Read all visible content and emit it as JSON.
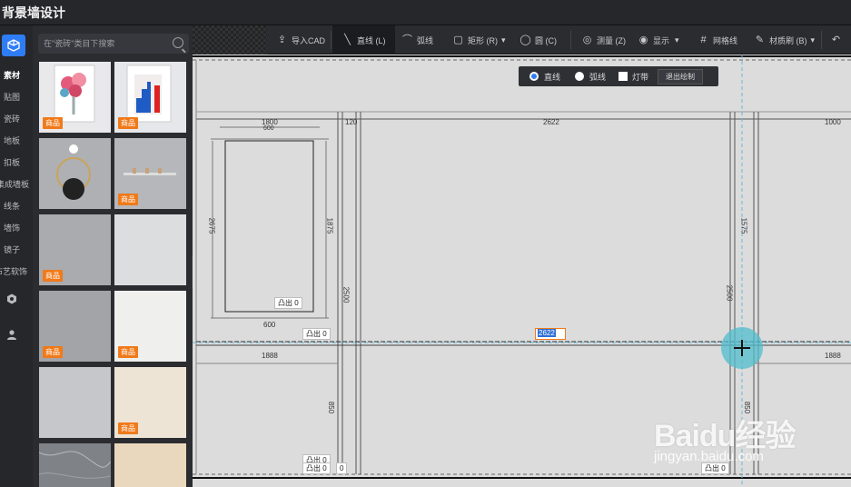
{
  "app": {
    "title": "背景墙设计"
  },
  "rail": {
    "items": [
      {
        "label": "素材",
        "active": true
      },
      {
        "label": "贴图"
      },
      {
        "label": "瓷砖"
      },
      {
        "label": "地板"
      },
      {
        "label": "扣板"
      },
      {
        "label": "集成墙板"
      },
      {
        "label": "线条"
      },
      {
        "label": "墙饰"
      },
      {
        "label": "镜子"
      },
      {
        "label": "布艺软饰"
      }
    ],
    "bottom_icons": [
      "hexagon-icon",
      "user-icon"
    ]
  },
  "library": {
    "search_placeholder": "在\"瓷砖\"类目下搜索",
    "tag_label": "商品",
    "tiles": [
      {
        "kind": "flower-frame",
        "tag": true
      },
      {
        "kind": "blue-stairs-frame",
        "tag": true
      },
      {
        "kind": "round-mirror",
        "tag": false
      },
      {
        "kind": "wall-shelf",
        "tag": true
      },
      {
        "kind": "grey-texture",
        "tag": true
      },
      {
        "kind": "light-grey-texture",
        "tag": false
      },
      {
        "kind": "mid-grey-texture",
        "tag": true
      },
      {
        "kind": "white-texture",
        "tag": true
      },
      {
        "kind": "pale-grey",
        "tag": false
      },
      {
        "kind": "cream-texture",
        "tag": true
      },
      {
        "kind": "marble",
        "tag": false
      },
      {
        "kind": "beige",
        "tag": false
      }
    ]
  },
  "toolbar": {
    "import_cad": "导入CAD",
    "line": "直线 (L)",
    "arc": "弧线",
    "rect": "矩形 (R)",
    "circle": "圆 (C)",
    "measure": "测量 (Z)",
    "display": "显示",
    "grid": "网格线",
    "material_brush": "材质刷 (B)"
  },
  "drawbar": {
    "line": "直线",
    "arc": "弧线",
    "light_strip": "灯带",
    "exit": "退出绘制"
  },
  "canvas": {
    "dims": {
      "top_1800": "1800",
      "top_600": "600",
      "top_120": "120",
      "top_2622": "2622",
      "top_1000": "1000",
      "left_2675": "2675",
      "inner_1875": "1875",
      "v_2500_a": "2500",
      "v_2500_b": "2500",
      "v_1575": "1575",
      "bottom_600": "600",
      "mid_1888_left": "1888",
      "mid_1888_right": "1888",
      "v_850": "850",
      "v_850_b": "850"
    },
    "offset_label": "凸出",
    "offset_value": "0",
    "edit_value": "2622"
  },
  "watermark": {
    "brand": "Baidu经验",
    "url": "jingyan.baidu.com"
  }
}
